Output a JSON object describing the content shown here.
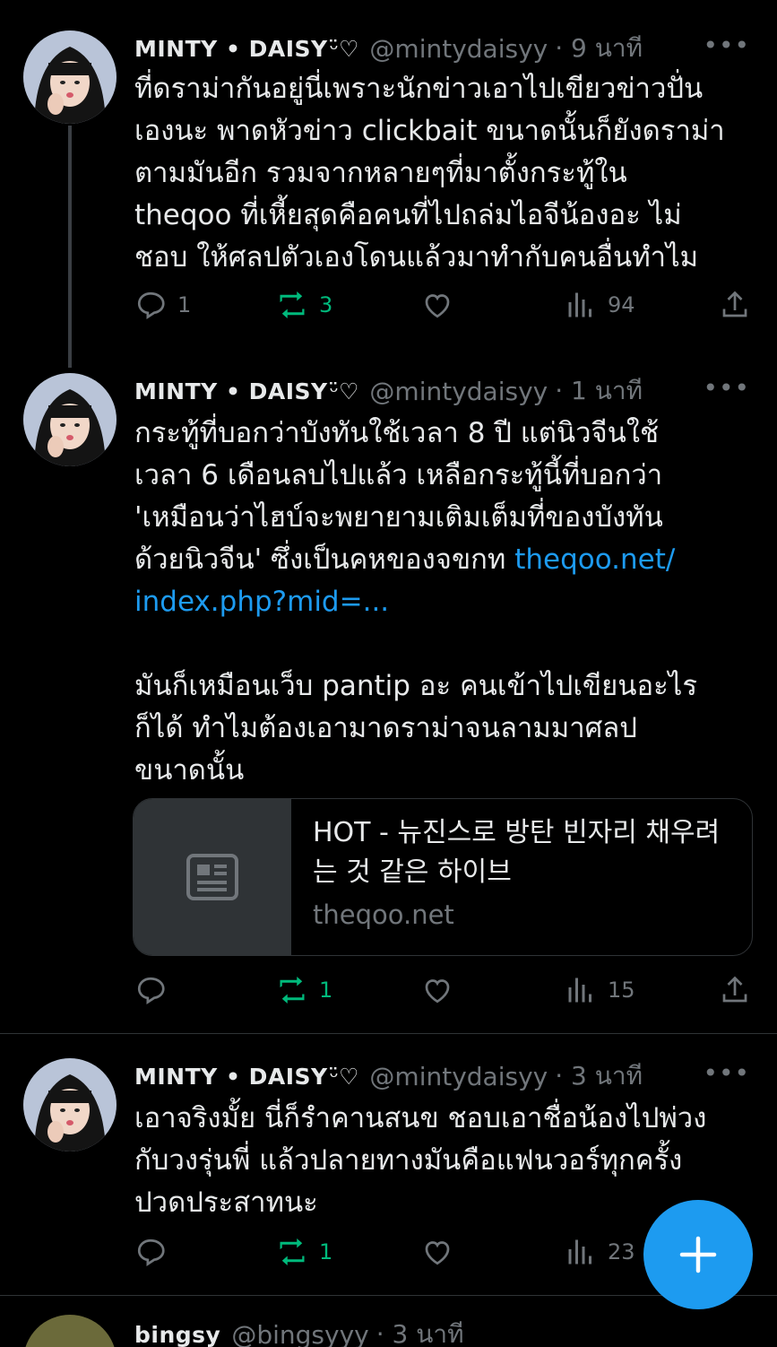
{
  "user": {
    "display_name": "MINTY • DAISY",
    "name_decoration": "ᵕ̈♡",
    "handle": "@mintydaisyy"
  },
  "tweets": [
    {
      "time": "· 9 นาที",
      "lines": [
        "ที่ดราม่ากันอยู่นี่เพราะนักข่าวเอาไปเขียวข่าวปั่น",
        "เองนะ พาดหัวข่าว clickbait ขนาดนั้นก็ยังดราม่า",
        "ตามมันอีก รวมจากหลายๆที่มาตั้งกระทู้ใน",
        "theqoo ที่เหี้ยสุดคือคนที่ไปถล่มไอจีน้องอะ ไม่",
        "ชอบ ให้ศลปตัวเองโดนแล้วมาทำกับคนอื่นทำไม"
      ],
      "replies": "1",
      "retweets": "3",
      "views": "94"
    },
    {
      "time": "· 1 นาที",
      "lines": [
        "กระทู้ที่บอกว่าบังทันใช้เวลา 8 ปี แต่นิวจีนใช้",
        "เวลา 6 เดือนลบไปแล้ว เหลือกระทู้นี้ที่บอกว่า",
        "'เหมือนว่าไฮบ์จะพยายามเติมเต็มที่ของบังทัน"
      ],
      "line4_text": "ด้วยนิวจีน' ซึ่งเป็นคหของจขกท ",
      "link_part1": "theqoo.net/",
      "link_part2": "index.php?mid=...",
      "lines_after": [
        "มันก็เหมือนเว็บ pantip อะ คนเข้าไปเขียนอะไร",
        "ก็ได้ ทำไมต้องเอามาดราม่าจนลามมาศลป",
        "ขนาดนั้น"
      ],
      "card": {
        "title": "HOT - 뉴진스로 방탄 빈자리 채우려는 것 같은 하이브",
        "domain": "theqoo.net"
      },
      "replies": "",
      "retweets": "1",
      "views": "15"
    },
    {
      "time": "· 3 นาที",
      "lines": [
        "เอาจริงมั้ย นี่ก็รำคานสนข ชอบเอาชื่อน้องไปพ่วง",
        "กับวงรุ่นพี่ แล้วปลายทางมันคือแฟนวอร์ทุกครั้ง",
        "ปวดประสาทนะ"
      ],
      "replies": "",
      "retweets": "1",
      "views": "23"
    }
  ],
  "next_tweet_partial": {
    "name": "bingsy",
    "handle": "@bingsyyy",
    "time": "· 3 นาที"
  },
  "more_glyph": "•••",
  "colors": {
    "background": "#000000",
    "text": "#e7e9ea",
    "muted": "#71767b",
    "link": "#1d9bf0",
    "retweet_green": "#00ba7c",
    "fab": "#1d9bf0"
  },
  "icons": [
    "reply-icon",
    "retweet-icon",
    "like-icon",
    "views-icon",
    "share-icon",
    "more-icon",
    "link-card-icon",
    "compose-plus-icon"
  ]
}
